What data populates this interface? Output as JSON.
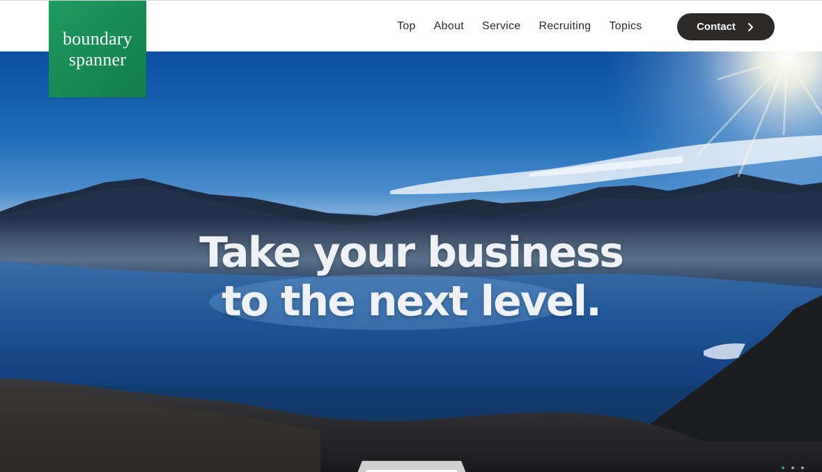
{
  "brand": {
    "logo_line1": "boundary",
    "logo_line2": "spanner",
    "logo_color": "#178a55"
  },
  "nav": {
    "items": [
      {
        "label": "Top"
      },
      {
        "label": "About"
      },
      {
        "label": "Service"
      },
      {
        "label": "Recruiting"
      },
      {
        "label": "Topics"
      }
    ],
    "contact_label": "Contact",
    "contact_icon": "chevron-right-icon",
    "contact_bg": "#2b2a28"
  },
  "hero": {
    "headline_line1": "Take your business",
    "headline_line2": "to the next level."
  }
}
